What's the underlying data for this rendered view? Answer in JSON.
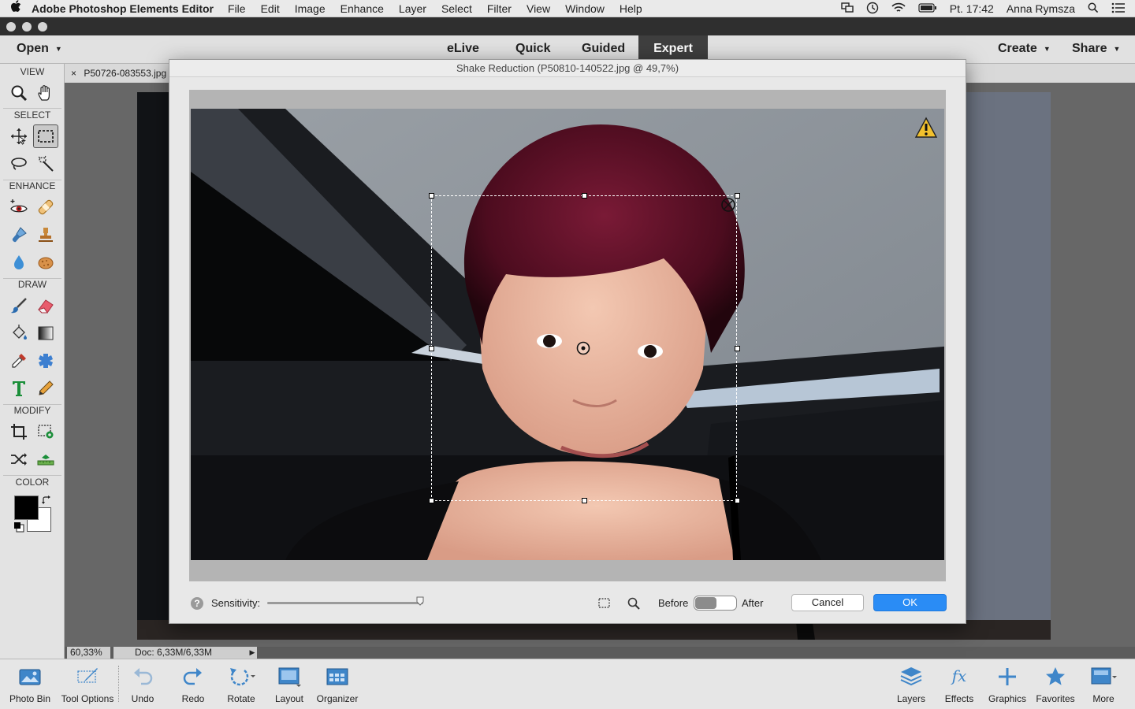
{
  "os_menubar": {
    "app_name": "Adobe Photoshop Elements Editor",
    "menus": [
      "File",
      "Edit",
      "Image",
      "Enhance",
      "Layer",
      "Select",
      "Filter",
      "View",
      "Window",
      "Help"
    ],
    "clock": "Pt. 17:42",
    "user": "Anna Rymsza"
  },
  "appbar": {
    "open_label": "Open",
    "modes": [
      "eLive",
      "Quick",
      "Guided",
      "Expert"
    ],
    "active_mode": "Expert",
    "create_label": "Create",
    "share_label": "Share"
  },
  "toolbox": {
    "sections": {
      "view": "VIEW",
      "select": "SELECT",
      "enhance": "ENHANCE",
      "draw": "DRAW",
      "modify": "MODIFY",
      "color": "COLOR"
    },
    "foreground_color": "#000000",
    "background_color": "#ffffff"
  },
  "document": {
    "tab_close": "×",
    "tab_name": "P50726-083553.jpg",
    "zoom": "60,33%",
    "doc_size": "Doc: 6,33M/6,33M"
  },
  "dialog": {
    "title": "Shake Reduction (P50810-140522.jpg @ 49,7%)",
    "sensitivity_label": "Sensitivity:",
    "sensitivity_value": 0.98,
    "before_label": "Before",
    "after_label": "After",
    "cancel_label": "Cancel",
    "ok_label": "OK",
    "accent": "#2a8cf5"
  },
  "taskbar": {
    "left": [
      "Photo Bin",
      "Tool Options",
      "Undo",
      "Redo",
      "Rotate",
      "Layout",
      "Organizer"
    ],
    "right": [
      "Layers",
      "Effects",
      "Graphics",
      "Favorites",
      "More"
    ]
  }
}
